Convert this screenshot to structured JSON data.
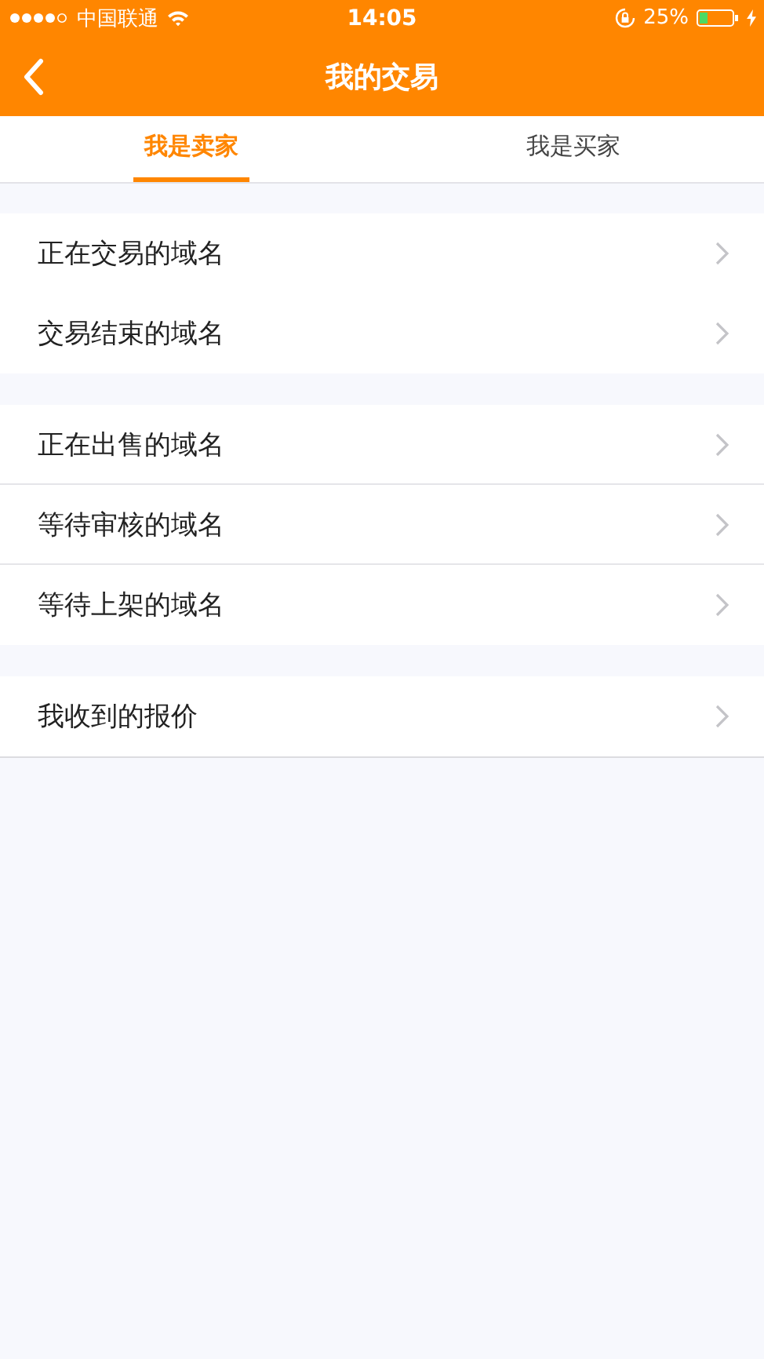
{
  "status_bar": {
    "carrier": "中国联通",
    "time": "14:05",
    "battery": "25%"
  },
  "nav_bar": {
    "title": "我的交易"
  },
  "tabs": [
    {
      "label": "我是卖家",
      "selected": true
    },
    {
      "label": "我是买家",
      "selected": false
    }
  ],
  "groups": [
    {
      "dividers": false,
      "items": [
        {
          "label": "正在交易的域名"
        },
        {
          "label": "交易结束的域名"
        }
      ]
    },
    {
      "dividers": true,
      "items": [
        {
          "label": "正在出售的域名"
        },
        {
          "label": "等待审核的域名"
        },
        {
          "label": "等待上架的域名"
        }
      ]
    },
    {
      "items": [
        {
          "label": "我收到的报价"
        }
      ]
    }
  ]
}
